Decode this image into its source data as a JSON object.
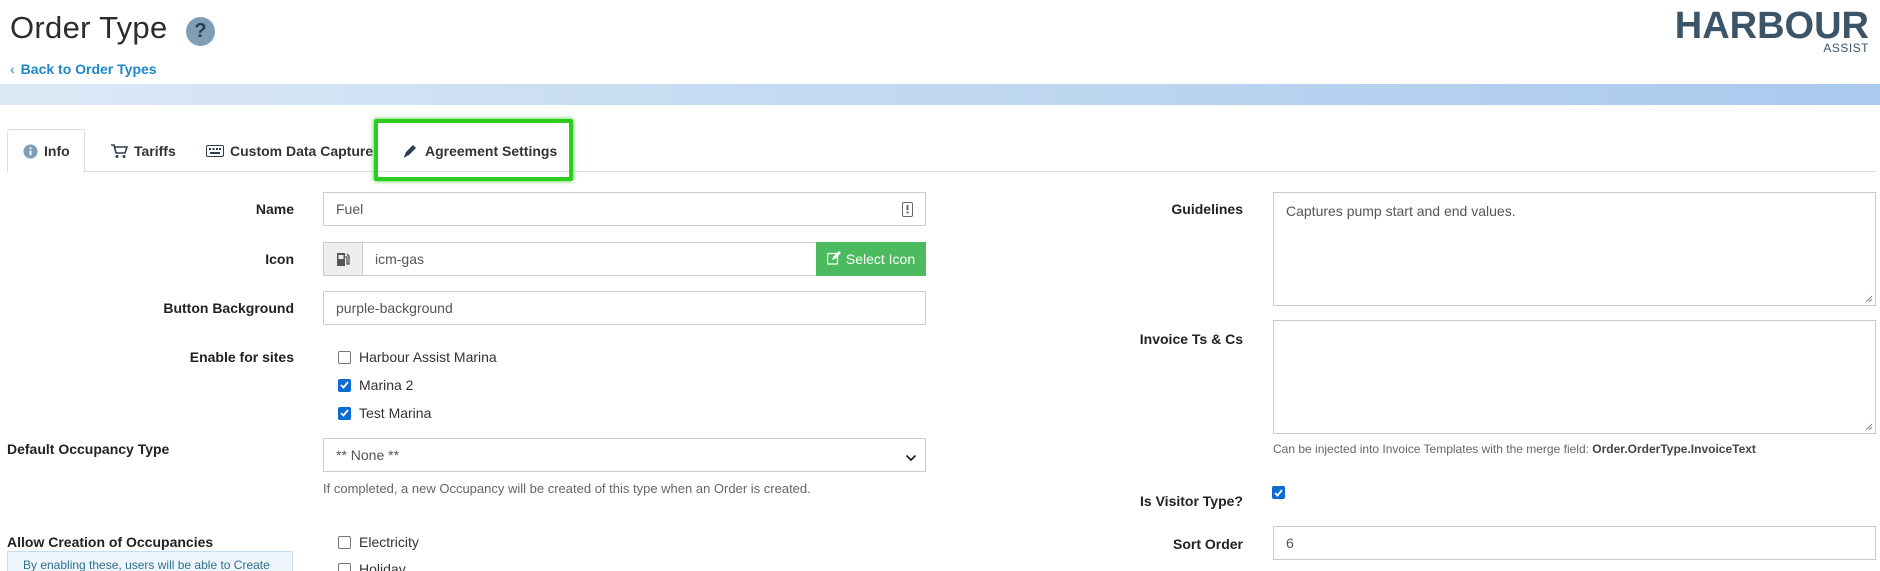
{
  "header": {
    "title": "Order Type",
    "help_glyph": "?",
    "back_link": "Back to Order Types",
    "logo_main": "HARBOUR",
    "logo_sub": "ASSIST"
  },
  "tabs": [
    {
      "label": "Info",
      "icon": "info-icon",
      "active": true
    },
    {
      "label": "Tariffs",
      "icon": "cart-icon",
      "active": false
    },
    {
      "label": "Custom Data Capture",
      "icon": "keyboard-icon",
      "active": false
    },
    {
      "label": "Agreement Settings",
      "icon": "pen-icon",
      "active": false
    }
  ],
  "form": {
    "name_label": "Name",
    "name_value": "Fuel",
    "icon_label": "Icon",
    "icon_value": "icm-gas",
    "select_icon_button": "Select Icon",
    "button_bg_label": "Button Background",
    "button_bg_value": "purple-background",
    "sites_label": "Enable for sites",
    "sites": [
      {
        "label": "Harbour Assist Marina",
        "checked": false
      },
      {
        "label": "Marina 2",
        "checked": true
      },
      {
        "label": "Test Marina",
        "checked": true
      }
    ],
    "occupancy_label": "Default Occupancy Type",
    "occupancy_value": "** None **",
    "occupancy_help": "If completed, a new Occupancy will be created of this type when an Order is created.",
    "allow_label": "Allow Creation of Occupancies",
    "allow_info": "By enabling these, users will be able to Create",
    "allow_options": [
      {
        "label": "Electricity",
        "checked": false
      },
      {
        "label": "Holiday",
        "checked": false
      }
    ],
    "guidelines_label": "Guidelines",
    "guidelines_value": "Captures pump start and end values.",
    "invoice_label": "Invoice Ts & Cs",
    "invoice_value": "",
    "invoice_help_prefix": "Can be injected into Invoice Templates with the merge field: ",
    "invoice_help_field": "Order.OrderType.InvoiceText",
    "visitor_label": "Is Visitor Type?",
    "visitor_checked": true,
    "sort_label": "Sort Order",
    "sort_value": "6"
  },
  "colors": {
    "accent": "#1e88c7",
    "success": "#4cbb5f",
    "highlight": "#2ecc1f",
    "checkbox": "#0b6bd3"
  }
}
